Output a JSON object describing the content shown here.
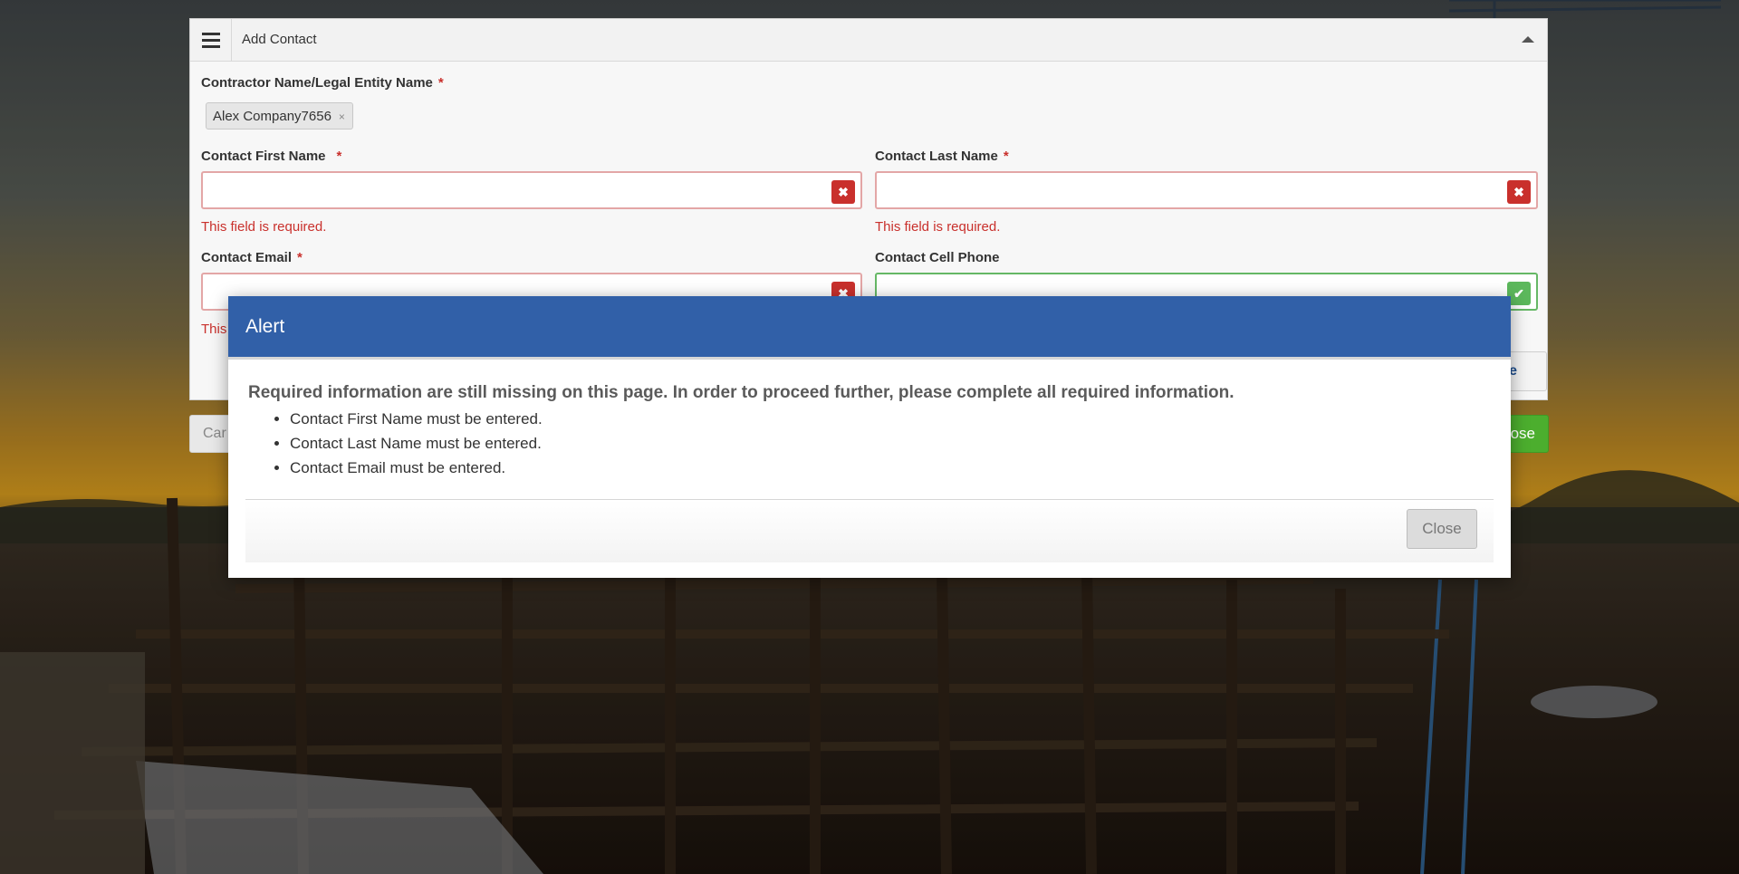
{
  "form": {
    "panel_title": "Add Contact",
    "contractor_label": "Contractor Name/Legal Entity Name",
    "contractor_tag": "Alex Company7656",
    "tag_remove": "×",
    "required_mark": "*",
    "first_name_label": "Contact First Name",
    "last_name_label": "Contact Last Name",
    "email_label": "Contact Email",
    "cell_phone_label": "Contact Cell Phone",
    "first_name_value": "",
    "last_name_value": "",
    "email_value": "",
    "cell_phone_value": "",
    "error_required": "This field is required.",
    "error_required_partial": "This",
    "inner_button_partial": "e",
    "cancel_partial": "Car",
    "close_partial": "ose"
  },
  "modal": {
    "title": "Alert",
    "message": "Required information are still missing on this page. In order to proceed further, please complete all required information.",
    "items": [
      "Contact First Name must be entered.",
      "Contact Last Name must be entered.",
      "Contact Email must be entered."
    ],
    "close_label": "Close"
  },
  "icons": {
    "menu": "hamburger-icon",
    "collapse": "caret-up-icon",
    "error": "times-icon",
    "valid": "check-icon"
  },
  "colors": {
    "modal_header": "#3160a8",
    "error": "#c9302c",
    "success": "#5cb85c",
    "primary_button": "#4cae2e"
  }
}
